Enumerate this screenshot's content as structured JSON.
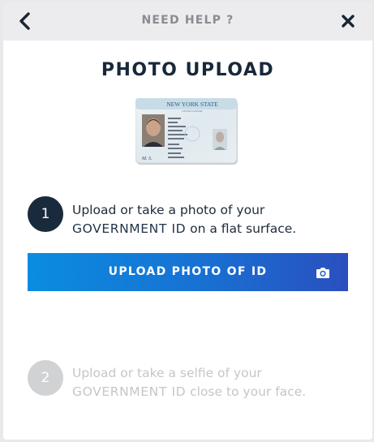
{
  "header": {
    "title": "NEED HELP ?",
    "back_icon": "chevron-left-icon",
    "close_icon": "close-icon"
  },
  "page": {
    "title": "PHOTO UPLOAD"
  },
  "id_card": {
    "state": "NEW YORK STATE",
    "sublabel": "DRIVER LICENSE"
  },
  "steps": [
    {
      "number": "1",
      "text_before": "Upload or take a photo of your",
      "emphasis": "GOVERNMENT ID",
      "text_after": " on a flat surface."
    },
    {
      "number": "2",
      "text_before": "Upload or take a selfie of your",
      "emphasis": "GOVERNMENT ID",
      "text_after": " close to your face."
    }
  ],
  "upload_button": {
    "label": "UPLOAD PHOTO OF ID",
    "icon": "camera-icon"
  },
  "colors": {
    "header_bg": "#ececee",
    "title": "#18283a",
    "step_active": "#192a3d",
    "step_inactive": "#d1d2d4",
    "button_start": "#0a8de0",
    "button_end": "#2a4fbe"
  }
}
